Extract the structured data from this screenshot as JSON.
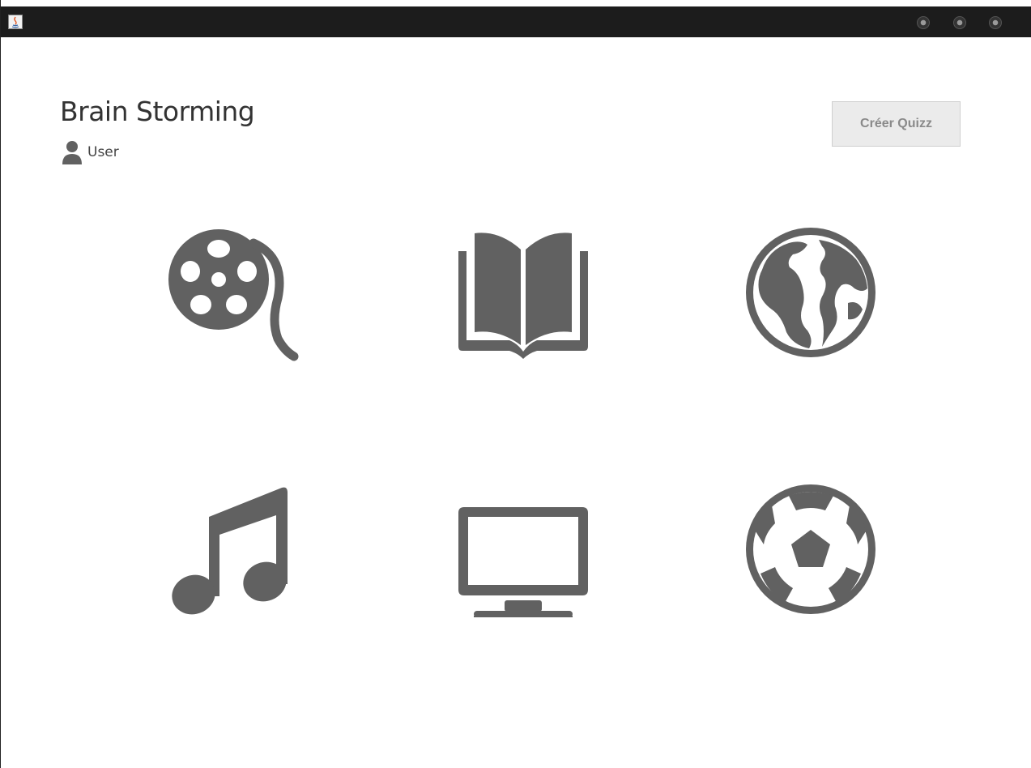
{
  "app": {
    "title": "Brain Storming",
    "user_label": "User"
  },
  "toolbar": {
    "create_quiz_label": "Créer Quizz"
  },
  "icons": {
    "app": "java-icon",
    "user": "user-icon",
    "window_buttons": [
      "minimize-icon",
      "maximize-icon",
      "close-icon"
    ]
  },
  "categories": [
    {
      "id": "movies",
      "icon": "film-reel-icon"
    },
    {
      "id": "books",
      "icon": "open-book-icon"
    },
    {
      "id": "geography",
      "icon": "globe-icon"
    },
    {
      "id": "music",
      "icon": "music-note-icon"
    },
    {
      "id": "tv",
      "icon": "monitor-icon"
    },
    {
      "id": "sport",
      "icon": "soccer-ball-icon"
    }
  ],
  "colors": {
    "icon": "#616161",
    "titlebar": "#1c1c1c",
    "button_bg": "#ebebeb",
    "button_text": "#8a8a8a"
  }
}
